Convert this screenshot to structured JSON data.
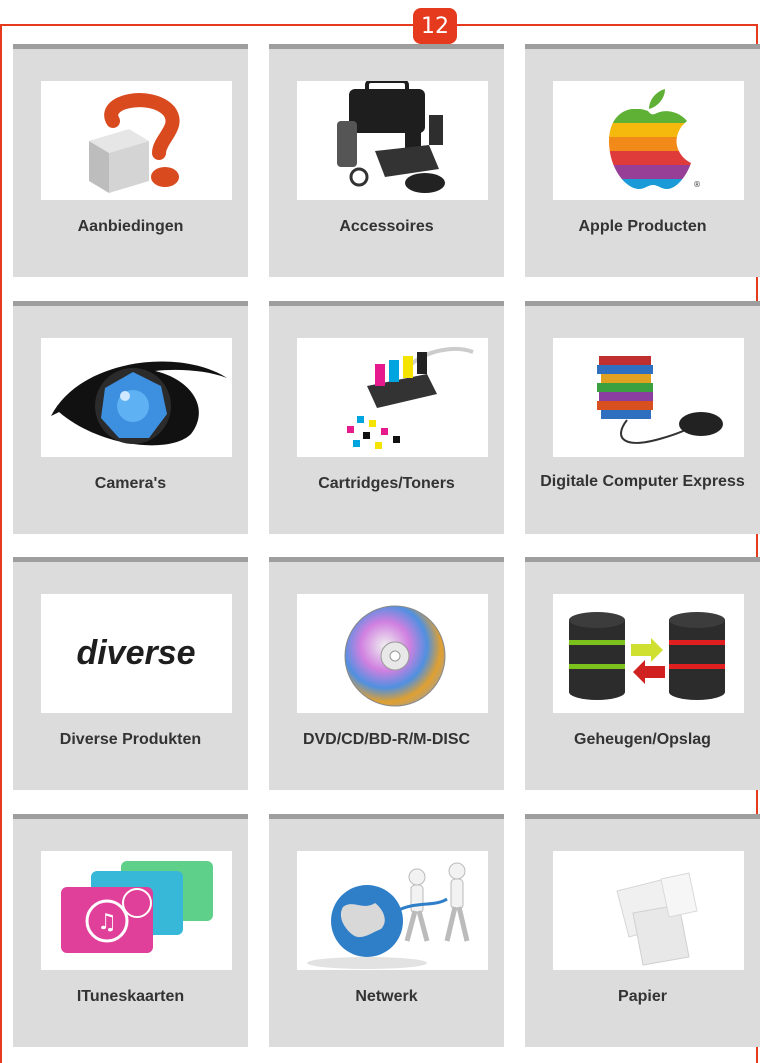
{
  "badge": {
    "number": "12"
  },
  "colors": {
    "frame": "#e53a1e",
    "tile_bg": "#dcdcdc",
    "tile_top": "#9e9e9e"
  },
  "categories": [
    {
      "label": "Aanbiedingen",
      "icon": "question-mark-box-icon"
    },
    {
      "label": "Accessoires",
      "icon": "computer-accessories-icon"
    },
    {
      "label": "Apple Producten",
      "icon": "apple-logo-icon"
    },
    {
      "label": "Camera's",
      "icon": "eye-lens-icon"
    },
    {
      "label": "Cartridges/Toners",
      "icon": "ink-cartridge-icon"
    },
    {
      "label": "Digitale Computer Express",
      "icon": "books-mouse-icon"
    },
    {
      "label": "Diverse Produkten",
      "icon": "diverse-logo-icon",
      "logo_text": "diverse"
    },
    {
      "label": "DVD/CD/BD-R/M-DISC",
      "icon": "disc-icon"
    },
    {
      "label": "Geheugen/Opslag",
      "icon": "database-sync-icon"
    },
    {
      "label": "ITuneskaarten",
      "icon": "itunes-cards-icon"
    },
    {
      "label": "Netwerk",
      "icon": "network-globe-icon"
    },
    {
      "label": "Papier",
      "icon": "paper-sheets-icon"
    }
  ]
}
